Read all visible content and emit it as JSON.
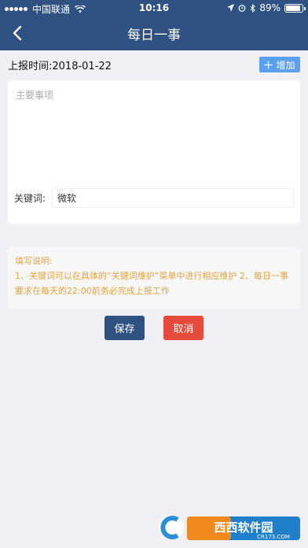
{
  "status_bar": {
    "carrier": "中国联通",
    "time": "10:16",
    "battery": "89%",
    "battery_level": 0.89
  },
  "header": {
    "title": "每日一事"
  },
  "report": {
    "date_label": "上报时间:2018-01-22",
    "add_label": "增加"
  },
  "form": {
    "main_placeholder": "主要事项",
    "keyword_label": "关键词:",
    "keyword_value": "微软"
  },
  "note": {
    "title": "填写说明:",
    "body": "1、关键词可以在具体的“关键词维护”菜单中进行相应维护 2、每日一事要求在每天的22:00前务必完成上报工作"
  },
  "actions": {
    "save": "保存",
    "cancel": "取消"
  },
  "watermark": {
    "text": "西西软件园",
    "sub": "CR173.COM"
  },
  "colors": {
    "header": "#2f5283",
    "add": "#5b9ff0",
    "cancel": "#e54a3c",
    "note_text": "#e4a33e"
  }
}
